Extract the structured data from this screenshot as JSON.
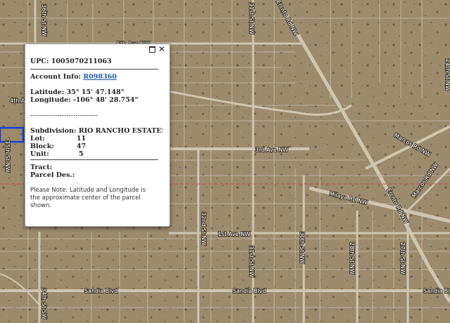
{
  "map": {
    "streets": [
      {
        "id": "5th-ave-nw",
        "label": "5th Ave NW"
      },
      {
        "id": "4th-ave",
        "label": "4th A"
      },
      {
        "id": "3rd-ave-nw",
        "label": "3rd Ave NW"
      },
      {
        "id": "1st-ave-nw",
        "label": "1st Ave NW"
      },
      {
        "id": "sandia-blvd-1",
        "label": "Sandia Blvd"
      },
      {
        "id": "sandia-blvd-2",
        "label": "Sandia Blvd"
      },
      {
        "id": "sandia-blvd-3",
        "label": "Sandia Blvd"
      },
      {
        "id": "36th-st-nw",
        "label": "36th St NW"
      },
      {
        "id": "35th-st-nw",
        "label": "35th St NW"
      },
      {
        "id": "34th-st-sw",
        "label": "34th St SW"
      },
      {
        "id": "31st-st-nw-top",
        "label": "31st St NW"
      },
      {
        "id": "32nd-st-nw",
        "label": "32nd St NW"
      },
      {
        "id": "31st-st-nw",
        "label": "31st St NW"
      },
      {
        "id": "30th-st-nw",
        "label": "30th St NW"
      },
      {
        "id": "28th-st-nw",
        "label": "28th St NW"
      },
      {
        "id": "27th-st-nw",
        "label": "27th St NW"
      },
      {
        "id": "24th-st-nw",
        "label": "24th St NW"
      },
      {
        "id": "enchanted-rd-nw-top",
        "label": "Ercnto Rd NW"
      },
      {
        "id": "enchanted-rd-nw",
        "label": "Ercnto Rd NW"
      },
      {
        "id": "marcos-rd-nw",
        "label": "Marcos Rd NW"
      },
      {
        "id": "marcos-rd-nw-2",
        "label": "Marcos Rd NW"
      },
      {
        "id": "milaya-rd-nw",
        "label": "Milaya Rd NW"
      }
    ]
  },
  "popup": {
    "upc_label": "UPC:",
    "upc_value": "1005070211063",
    "account_label": "Account Info:",
    "account_value": "R098360",
    "latitude_label": "Latitude:",
    "latitude_value": "35° 15' 47.148\"",
    "longitude_label": "Longitude:",
    "longitude_value": "-106° 48' 28.754\"",
    "divider": "------------------------------",
    "subdivision_label": "Subdivision:",
    "subdivision_value": "RIO RANCHO ESTATES",
    "lot_label": "Lot:",
    "lot_value": "11",
    "block_label": "Block:",
    "block_value": "47",
    "unit_label": "Unit:",
    "unit_value": "5",
    "tract_label": "Tract:",
    "parcel_label": "Parcel Des.:",
    "note": "Please Note: Latitude and Longitude is the approximate center of the parcel shown.",
    "close_glyph": "✕"
  },
  "colors": {
    "terrain": "#9b8a6c",
    "parcel_line": "#d8d3c6",
    "selected_parcel": "#1a3fd6",
    "boundary_dashed": "#cf3b3b",
    "link": "#1f5aa3"
  }
}
